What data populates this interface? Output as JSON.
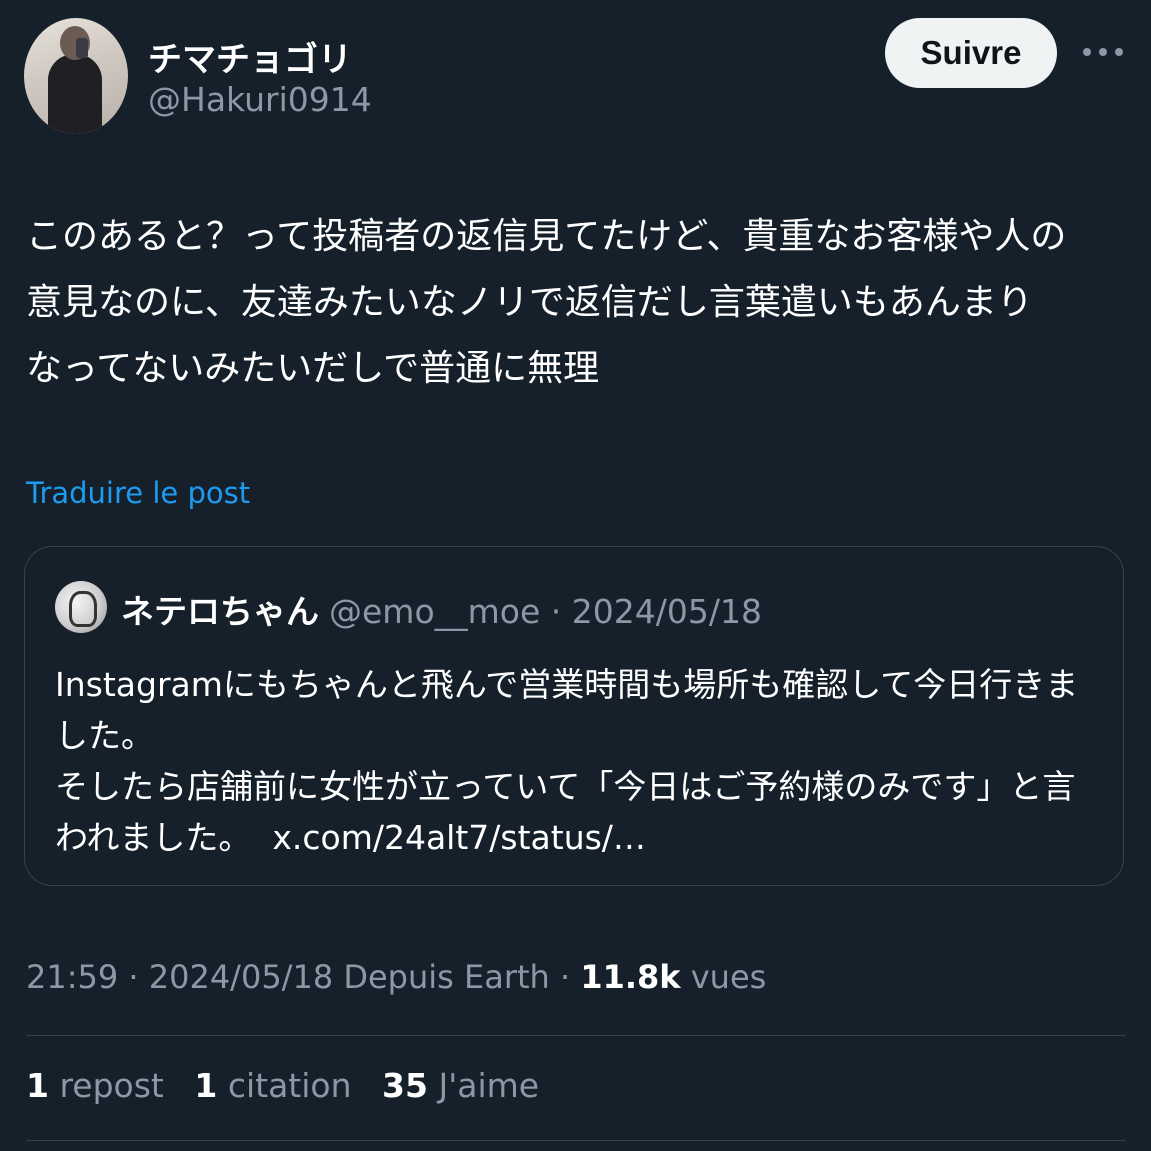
{
  "author": {
    "display_name": "チマチョゴリ",
    "handle": "@Hakuri0914"
  },
  "follow_label": "Suivre",
  "post": {
    "lines": [
      "このあると？って投稿者の返信見てたけど、貴重なお客様や人の",
      "意見なのに、友達みたいなノリで返信だし言葉遣いもあんまり",
      "なってないみたいだしで普通に無理"
    ],
    "translate_label": "Traduire le post"
  },
  "quote": {
    "name": "ネテロちゃん",
    "meta": "@emo__moe · 2024/05/18",
    "lines": [
      "Instagramにもちゃんと飛んで営業時間も場所も確認して今日行きま",
      "した。",
      "そしたら店舗前に女性が立っていて「今日はご予約様のみです」と言",
      "われました。"
    ],
    "link": "x.com/24alt7/status/…"
  },
  "meta": {
    "time_date_source": "21:59 · 2024/05/18 Depuis Earth · ",
    "views_count": "11.8k",
    "views_label": " vues"
  },
  "stats": {
    "reposts_count": "1",
    "reposts_label": " repost",
    "quotes_count": "1",
    "quotes_label": " citation",
    "likes_count": "35",
    "likes_label": " J'aime"
  }
}
